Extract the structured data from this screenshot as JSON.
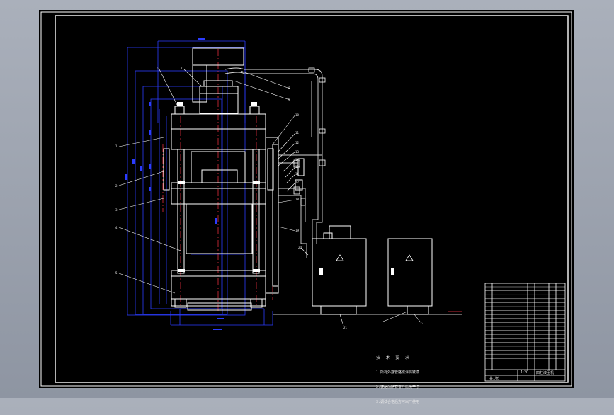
{
  "colors": {
    "background": "#000000",
    "frame": "#ffffff",
    "outline": "#ffffff",
    "dimension": "#2b3cff",
    "centerline": "#ff3344",
    "pipe": "#d8d8d8",
    "label": "#e8e8e8"
  },
  "drawing": {
    "balloons": [
      "1",
      "2",
      "3",
      "4",
      "5",
      "6",
      "7",
      "8",
      "9",
      "10",
      "11",
      "12",
      "13",
      "14",
      "15",
      "16",
      "17",
      "18",
      "19",
      "20",
      "21",
      "22"
    ],
    "tech_notes_title": "技 术 要 求",
    "tech_notes": [
      "1.所有外露管路需涂防锈漆",
      "2.装配前所有零件清洗干净",
      "3.调试合格后方可出厂使用"
    ],
    "hazard_symbol": "⚠"
  },
  "title_block": {
    "drawing_name": "四柱液压机",
    "scale": "1:20",
    "sheet": "共1张"
  },
  "icons": [
    "hazard-icon"
  ]
}
